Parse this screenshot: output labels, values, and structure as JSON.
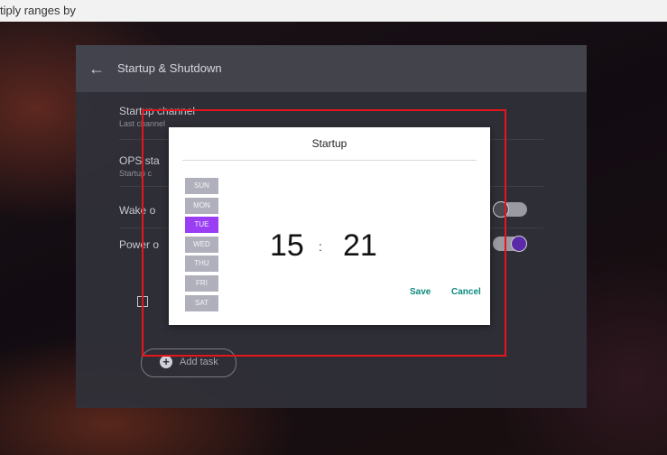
{
  "top_strip": {
    "text": "tiply ranges by"
  },
  "panel": {
    "title": "Startup & Shutdown",
    "settings": [
      {
        "label": "Startup channel",
        "sub": "Last channel"
      },
      {
        "label": "OPS sta",
        "sub": "Startup c"
      },
      {
        "label": "Wake o"
      },
      {
        "label": "Power o"
      }
    ],
    "toggles": {
      "wake": "off",
      "power": "on"
    },
    "add_task_label": "Add task"
  },
  "dialog": {
    "title": "Startup",
    "days": [
      "SUN",
      "MON",
      "TUE",
      "WED",
      "THU",
      "FRI",
      "SAT"
    ],
    "selected_day": "TUE",
    "hour": "15",
    "separator": ":",
    "minute": "21",
    "save_label": "Save",
    "cancel_label": "Cancel"
  },
  "colors": {
    "accent_purple": "#9b3df5",
    "action_teal": "#0b8a7e",
    "highlight_red": "#e4161c",
    "panel_bg": "#303038"
  },
  "icons": {
    "back": "arrow-left-icon",
    "add": "plus-circle-icon",
    "checkbox": "checkbox-icon"
  }
}
